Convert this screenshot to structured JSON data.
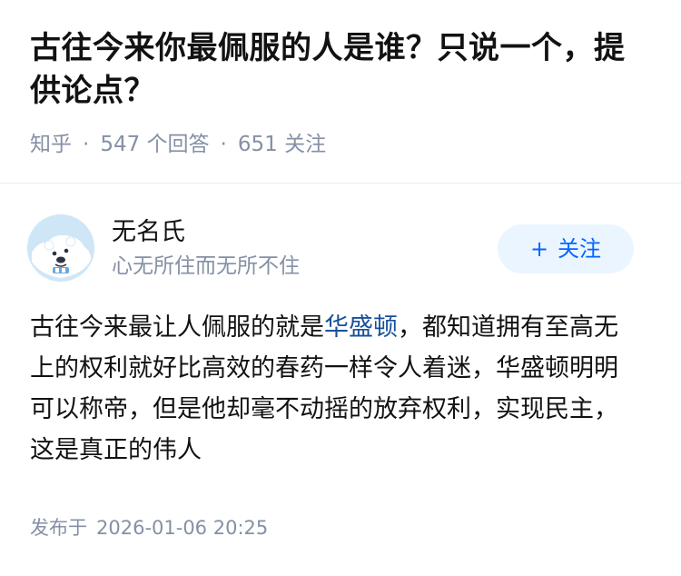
{
  "question": {
    "title": "古往今来你最佩服的人是谁？只说一个，提供论点？",
    "source": "知乎",
    "answer_count": "547",
    "answer_label": "个回答",
    "follower_count": "651",
    "follower_label": "关注",
    "separator": "·"
  },
  "answer": {
    "author": {
      "name": "无名氏",
      "bio": "心无所住而无所不住",
      "avatar_icon": "polar-bear-avatar"
    },
    "follow_button": {
      "icon": "+",
      "label": "关注"
    },
    "content": {
      "before_link": "古往今来最让人佩服的就是",
      "link_text": "华盛顿",
      "after_link": "，都知道拥有至高无上的权利就好比高效的春药一样令人着迷，华盛顿明明可以称帝，但是他却毫不动摇的放弃权利，实现民主，这是真正的伟人"
    },
    "published_label": "发布于",
    "published_time": "2026-01-06 20:25"
  },
  "colors": {
    "title": "#121212",
    "meta": "#8590a6",
    "accent": "#0066ff",
    "button_bg": "#ebf5ff",
    "link": "#175199"
  }
}
